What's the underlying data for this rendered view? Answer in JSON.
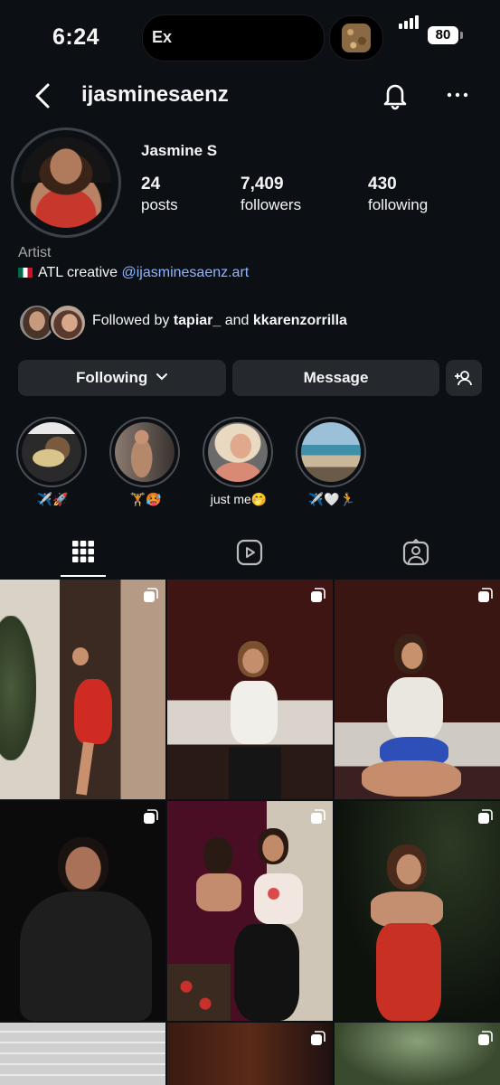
{
  "status_bar": {
    "time": "6:24",
    "island_label": "Ex",
    "battery": "80"
  },
  "header": {
    "username": "ijasminesaenz"
  },
  "profile": {
    "display_name": "Jasmine S",
    "stats": [
      {
        "value": "24",
        "label": "posts"
      },
      {
        "value": "7,409",
        "label": "followers"
      },
      {
        "value": "430",
        "label": "following"
      }
    ],
    "category": "Artist",
    "bio_text": "ATL creative ",
    "bio_link": "@ijasminesaenz.art",
    "followed_prefix": "Followed by ",
    "followed_user1": "tapiar_",
    "followed_and": " and ",
    "followed_user2": "kkarenzorrilla"
  },
  "buttons": {
    "following": "Following",
    "message": "Message"
  },
  "highlights": [
    {
      "caption": "✈️🚀"
    },
    {
      "caption": "🏋️🥵"
    },
    {
      "caption": "just me🤭"
    },
    {
      "caption": "✈️🤍🏃"
    }
  ],
  "tabs": [
    "grid-icon",
    "reels-icon",
    "tagged-icon"
  ],
  "colors": {
    "background": "#0c1014",
    "button": "#25292e",
    "link": "#8fb5ff",
    "secondary_text": "#a8a8a8"
  }
}
